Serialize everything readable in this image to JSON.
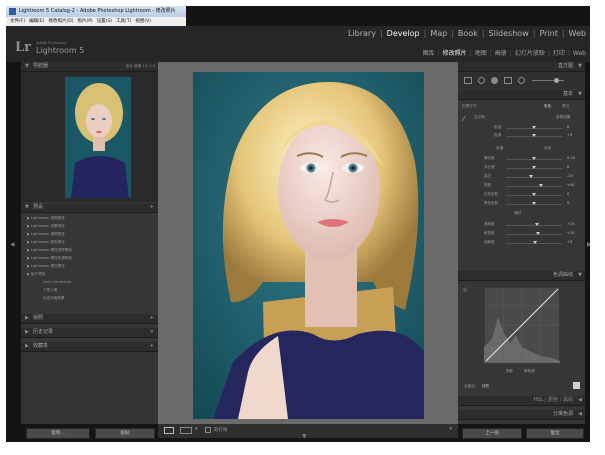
{
  "window": {
    "title": "Lightroom 5 Catalog-2 - Adobe Photoshop Lightroom - 修改照片",
    "menu": [
      "文件(F)",
      "编辑(E)",
      "修改照片(D)",
      "照片(P)",
      "设置(S)",
      "工具(T)",
      "视图(V)"
    ]
  },
  "identity": {
    "logo": "Lr",
    "adobe_small": "Adobe Photoshop",
    "app_name": "Lightroom 5"
  },
  "modules_en": {
    "items": [
      {
        "label": "Library",
        "active": false
      },
      {
        "label": "Develop",
        "active": true
      },
      {
        "label": "Map",
        "active": false
      },
      {
        "label": "Book",
        "active": false
      },
      {
        "label": "Slideshow",
        "active": false
      },
      {
        "label": "Print",
        "active": false
      },
      {
        "label": "Web",
        "active": false
      }
    ],
    "separator": "|"
  },
  "modules_cn": {
    "items": [
      {
        "label": "图库",
        "active": false
      },
      {
        "label": "修改照片",
        "active": true
      },
      {
        "label": "地图",
        "active": false
      },
      {
        "label": "画册",
        "active": false
      },
      {
        "label": "幻灯片放映",
        "active": false
      },
      {
        "label": "打印",
        "active": false
      },
      {
        "label": "Web",
        "active": false
      }
    ],
    "separator": "|"
  },
  "left_panel": {
    "navigator": {
      "title": "导航器",
      "zoom_options": [
        "适合",
        "填满",
        "1:1",
        "1:4"
      ]
    },
    "presets": {
      "title": "预设",
      "folders": [
        "Lightroom 常规预设",
        "Lightroom 效果预设",
        "Lightroom 视频预设",
        "Lightroom 颜色预设",
        "Lightroom 黑白滤镜预设",
        "Lightroom 黑白色调预设",
        "Lightroom 黑白预设",
        "用户预设"
      ],
      "user_presets": [
        "Lens Correction",
        "个性人像",
        "杂志封面效果"
      ]
    },
    "snapshots_title": "快照",
    "history_title": "历史记录",
    "collections_title": "收藏夹",
    "copy_button": "复制...",
    "paste_button": "粘贴"
  },
  "toolbar": {
    "softproof_label": "软打样"
  },
  "right_panel": {
    "histogram_title": "直方图",
    "basic": {
      "title": "基本",
      "treatment_label": "处理方式：",
      "treatment_options": [
        "彩色",
        "黑白"
      ],
      "wb_label": "白平衡：",
      "wb_value": "原照设置",
      "temp_label": "色温",
      "temp_value": "0",
      "tint_label": "色调",
      "tint_value": "+0",
      "tone_title": "色调",
      "auto_label": "自动",
      "tone_rows": [
        {
          "label": "曝光度",
          "value": "0.00",
          "pos": 0.5
        },
        {
          "label": "对比度",
          "value": "0",
          "pos": 0.5
        },
        {
          "label": "高光",
          "value": "-20",
          "pos": 0.44
        },
        {
          "label": "阴影",
          "value": "+40",
          "pos": 0.62
        },
        {
          "label": "白色色阶",
          "value": "0",
          "pos": 0.5
        },
        {
          "label": "黑色色阶",
          "value": "0",
          "pos": 0.5
        }
      ],
      "presence_title": "偏好",
      "presence_rows": [
        {
          "label": "清晰度",
          "value": "+15",
          "pos": 0.56
        },
        {
          "label": "鲜艳度",
          "value": "+20",
          "pos": 0.58
        },
        {
          "label": "饱和度",
          "value": "+5",
          "pos": 0.52
        }
      ]
    },
    "tone_curve": {
      "title": "色调曲线",
      "channel_label": "点曲线：",
      "channel_value": "线性",
      "zone_labels": [
        "阴影",
        "暗色调"
      ]
    },
    "hsl": {
      "title": "HSL",
      "tabs": [
        "HSL",
        "颜色",
        "黑白"
      ]
    },
    "split_toning": {
      "title": "分离色调"
    },
    "prev_button": "上一张",
    "reset_button": "复位"
  }
}
